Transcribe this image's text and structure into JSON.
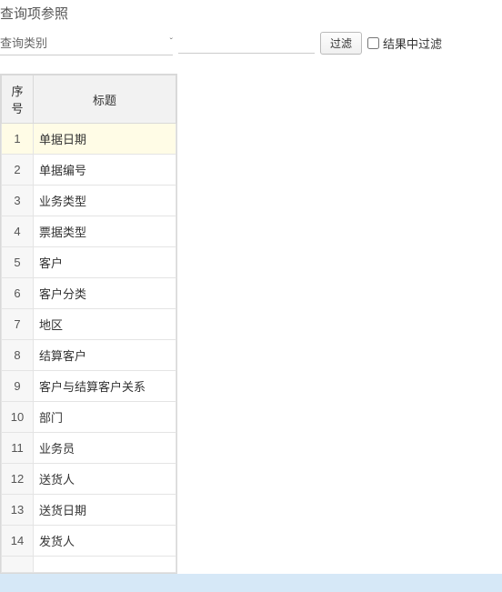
{
  "title": "查询项参照",
  "filter": {
    "select_label": "查询类别",
    "input_value": "",
    "filter_button": "过滤",
    "checkbox_label": "结果中过滤",
    "checkbox_checked": false
  },
  "table": {
    "headers": {
      "index": "序号",
      "title": "标题"
    },
    "rows": [
      {
        "idx": "1",
        "title": "单据日期",
        "selected": true
      },
      {
        "idx": "2",
        "title": "单据编号",
        "selected": false
      },
      {
        "idx": "3",
        "title": "业务类型",
        "selected": false
      },
      {
        "idx": "4",
        "title": "票据类型",
        "selected": false
      },
      {
        "idx": "5",
        "title": "客户",
        "selected": false
      },
      {
        "idx": "6",
        "title": "客户分类",
        "selected": false
      },
      {
        "idx": "7",
        "title": "地区",
        "selected": false
      },
      {
        "idx": "8",
        "title": "结算客户",
        "selected": false
      },
      {
        "idx": "9",
        "title": "客户与结算客户关系",
        "selected": false
      },
      {
        "idx": "10",
        "title": "部门",
        "selected": false
      },
      {
        "idx": "11",
        "title": "业务员",
        "selected": false
      },
      {
        "idx": "12",
        "title": "送货人",
        "selected": false
      },
      {
        "idx": "13",
        "title": "送货日期",
        "selected": false
      },
      {
        "idx": "14",
        "title": "发货人",
        "selected": false
      }
    ]
  }
}
